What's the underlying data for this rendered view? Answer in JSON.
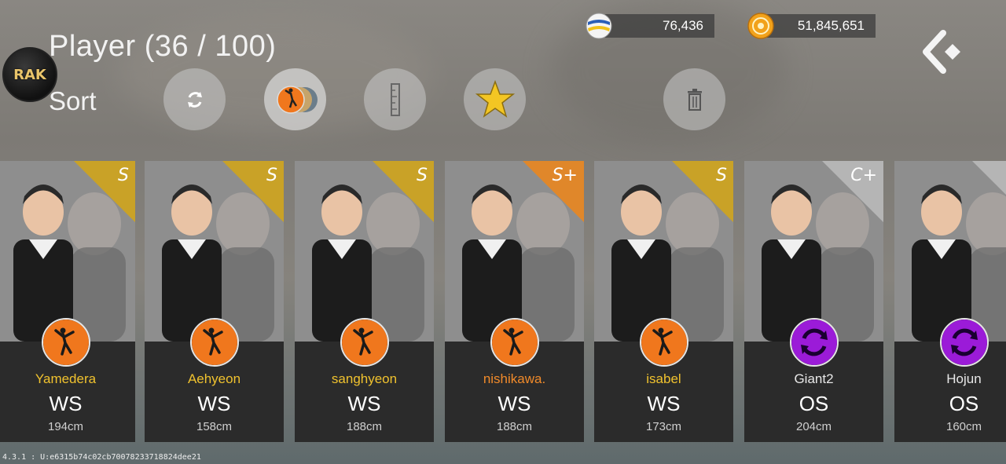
{
  "header": {
    "title": "Player (36 / 100)",
    "sort_label": "Sort",
    "logo_text": "RAK"
  },
  "currency": {
    "balls": "76,436",
    "coins": "51,845,651"
  },
  "sort_buttons": [
    {
      "name": "refresh-sort-button",
      "icon": "refresh-icon"
    },
    {
      "name": "position-sort-button",
      "icon": "volleyball-player-icon"
    },
    {
      "name": "height-sort-button",
      "icon": "ruler-icon"
    },
    {
      "name": "favorite-sort-button",
      "icon": "star-icon"
    },
    {
      "name": "delete-button",
      "icon": "trash-icon"
    }
  ],
  "colors": {
    "rank_s": "#c9a227",
    "rank_splus": "#e0872a",
    "rank_cplus": "#b5b5b5",
    "name_gold": "#f0c22e",
    "name_orange": "#f08a2a",
    "name_white": "#e8e8e8",
    "role_ws": "#f0771d",
    "role_os": "#9b1bd8"
  },
  "players": [
    {
      "name": "Yamedera",
      "position": "WS",
      "height": "194cm",
      "rank": "S",
      "name_color": "#f0c22e",
      "rank_color": "#c9a227",
      "role": "ws"
    },
    {
      "name": "Aehyeon",
      "position": "WS",
      "height": "158cm",
      "rank": "S",
      "name_color": "#f0c22e",
      "rank_color": "#c9a227",
      "role": "ws"
    },
    {
      "name": "sanghyeon",
      "position": "WS",
      "height": "188cm",
      "rank": "S",
      "name_color": "#f0c22e",
      "rank_color": "#c9a227",
      "role": "ws"
    },
    {
      "name": "nishikawa.",
      "position": "WS",
      "height": "188cm",
      "rank": "S+",
      "name_color": "#f08a2a",
      "rank_color": "#e0872a",
      "role": "ws"
    },
    {
      "name": "isabel",
      "position": "WS",
      "height": "173cm",
      "rank": "S",
      "name_color": "#f0c22e",
      "rank_color": "#c9a227",
      "role": "ws"
    },
    {
      "name": "Giant2",
      "position": "OS",
      "height": "204cm",
      "rank": "C+",
      "name_color": "#e8e8e8",
      "rank_color": "#b5b5b5",
      "role": "os"
    },
    {
      "name": "Hojun",
      "position": "OS",
      "height": "160cm",
      "rank": "",
      "name_color": "#e8e8e8",
      "rank_color": "#b5b5b5",
      "role": "os"
    }
  ],
  "version": "4.3.1 : U:e6315b74c02cb70078233718824dee21"
}
